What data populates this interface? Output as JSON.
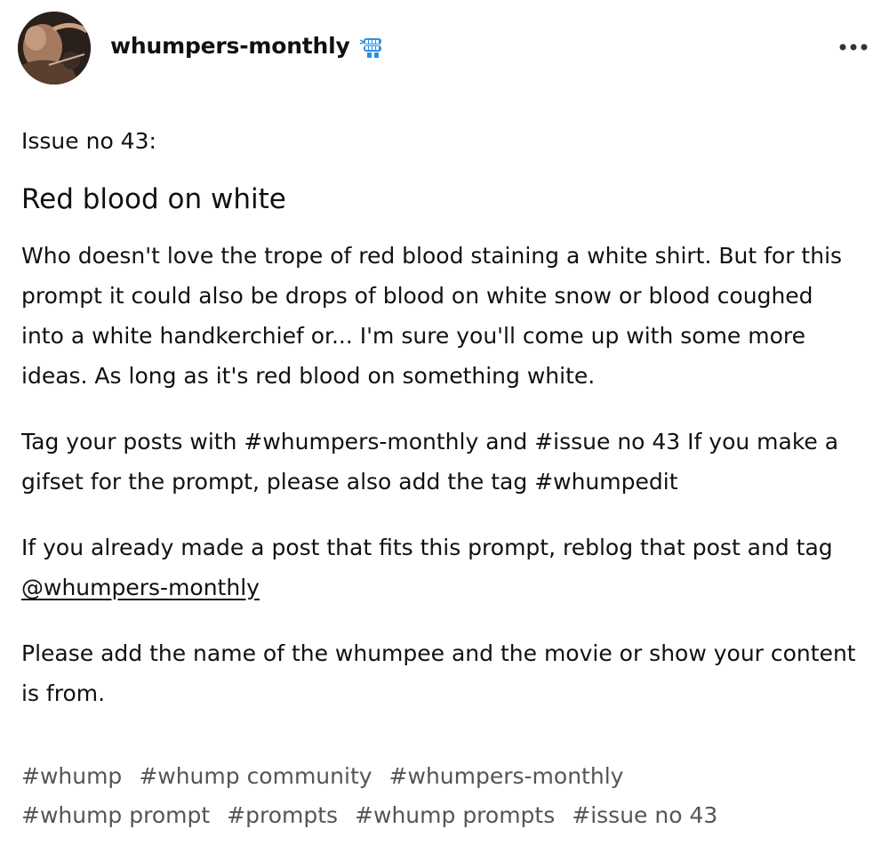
{
  "post": {
    "blog_name": "whumpers-monthly",
    "avatar_icon": "blog-avatar",
    "badge_icon": "wind-up-teeth-icon",
    "more_icon": "ellipsis-icon",
    "issue_label": "Issue no 43:",
    "heading": "Red blood on white",
    "paragraph1": "Who doesn't love the trope of red blood staining a white shirt. But for this prompt it could also be drops of blood on white snow or blood coughed into a white handkerchief or... I'm sure you'll come up with some more ideas. As long as it's red blood on something white.",
    "paragraph2": "Tag your posts with #whumpers-monthly and #issue no 43 If you make a gifset for the prompt, please also add the tag #whumpedit",
    "paragraph3_before": "If you already made a post that fits this prompt, reblog that post and tag ",
    "paragraph3_mention": "@whumpers-monthly",
    "paragraph4": "Please add the name of the whumpee and the movie or show your content is from.",
    "tags": [
      "#whump",
      "#whump community",
      "#whumpers-monthly",
      "#whump prompt",
      "#prompts",
      "#whump prompts",
      "#issue no 43"
    ]
  },
  "colors": {
    "text": "#111111",
    "tag_text": "#555555",
    "badge_blue": "#2f8fe0"
  }
}
